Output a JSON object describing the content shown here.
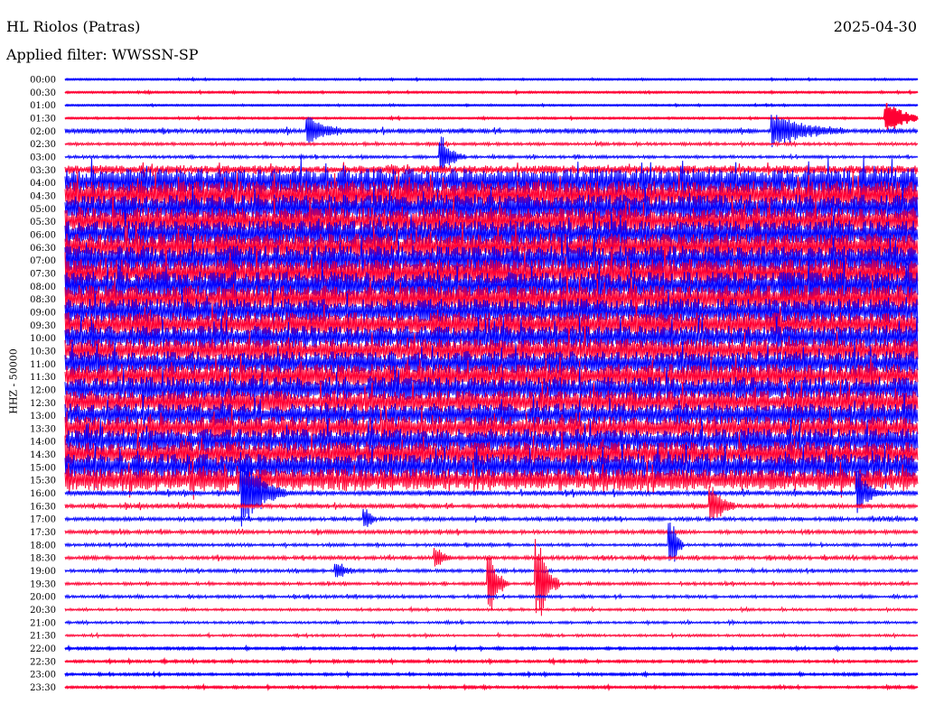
{
  "header": {
    "station": "HL Riolos (Patras)",
    "date": "2025-04-30",
    "filter": "Applied filter: WWSSN-SP"
  },
  "chart_data": {
    "type": "line",
    "title": "HL Riolos (Patras)",
    "ylabel": "HHZ - 50000",
    "minutes_per_line": 30,
    "colors": [
      "#0000ff",
      "#ff0033"
    ],
    "rows": [
      "00:00",
      "00:30",
      "01:00",
      "01:30",
      "02:00",
      "02:30",
      "03:00",
      "03:30",
      "04:00",
      "04:30",
      "05:00",
      "05:30",
      "06:00",
      "06:30",
      "07:00",
      "07:30",
      "08:00",
      "08:30",
      "09:00",
      "09:30",
      "10:00",
      "10:30",
      "11:00",
      "11:30",
      "12:00",
      "12:30",
      "13:00",
      "13:30",
      "14:00",
      "14:30",
      "15:00",
      "15:30",
      "16:00",
      "16:30",
      "17:00",
      "17:30",
      "18:00",
      "18:30",
      "19:00",
      "19:30",
      "20:00",
      "20:30",
      "21:00",
      "21:30",
      "22:00",
      "22:30",
      "23:00",
      "23:30"
    ],
    "noise_level": [
      0.05,
      0.06,
      0.05,
      0.06,
      0.2,
      0.12,
      0.12,
      0.35,
      1.1,
      1.15,
      1.1,
      1.1,
      1.1,
      1.1,
      1.15,
      1.1,
      1.15,
      1.1,
      1.05,
      1.0,
      0.95,
      0.95,
      1.0,
      1.0,
      1.0,
      0.95,
      0.95,
      0.95,
      1.0,
      1.0,
      1.05,
      0.9,
      0.2,
      0.18,
      0.15,
      0.15,
      0.12,
      0.15,
      0.13,
      0.12,
      0.12,
      0.1,
      0.1,
      0.1,
      0.08,
      0.08,
      0.08,
      0.08
    ],
    "events": [
      {
        "row": 3,
        "minute": 29,
        "amp": 1.2,
        "dur": 1.5
      },
      {
        "row": 4,
        "minute": 8.6,
        "amp": 1.0,
        "dur": 1.5
      },
      {
        "row": 4,
        "minute": 25,
        "amp": 1.3,
        "dur": 2.5
      },
      {
        "row": 6,
        "minute": 13.3,
        "amp": 1.6,
        "dur": 0.8
      },
      {
        "row": 32,
        "minute": 6.3,
        "amp": 3.0,
        "dur": 1.5
      },
      {
        "row": 32,
        "minute": 28,
        "amp": 1.6,
        "dur": 0.8
      },
      {
        "row": 33,
        "minute": 22.8,
        "amp": 1.8,
        "dur": 0.8
      },
      {
        "row": 34,
        "minute": 10.6,
        "amp": 0.8,
        "dur": 0.4
      },
      {
        "row": 36,
        "minute": 21.4,
        "amp": 2.0,
        "dur": 0.4
      },
      {
        "row": 37,
        "minute": 13.1,
        "amp": 0.8,
        "dur": 0.5
      },
      {
        "row": 38,
        "minute": 9.6,
        "amp": 0.7,
        "dur": 0.6
      },
      {
        "row": 39,
        "minute": 15,
        "amp": 2.6,
        "dur": 0.6
      },
      {
        "row": 39,
        "minute": 16.7,
        "amp": 3.4,
        "dur": 0.7
      }
    ]
  }
}
